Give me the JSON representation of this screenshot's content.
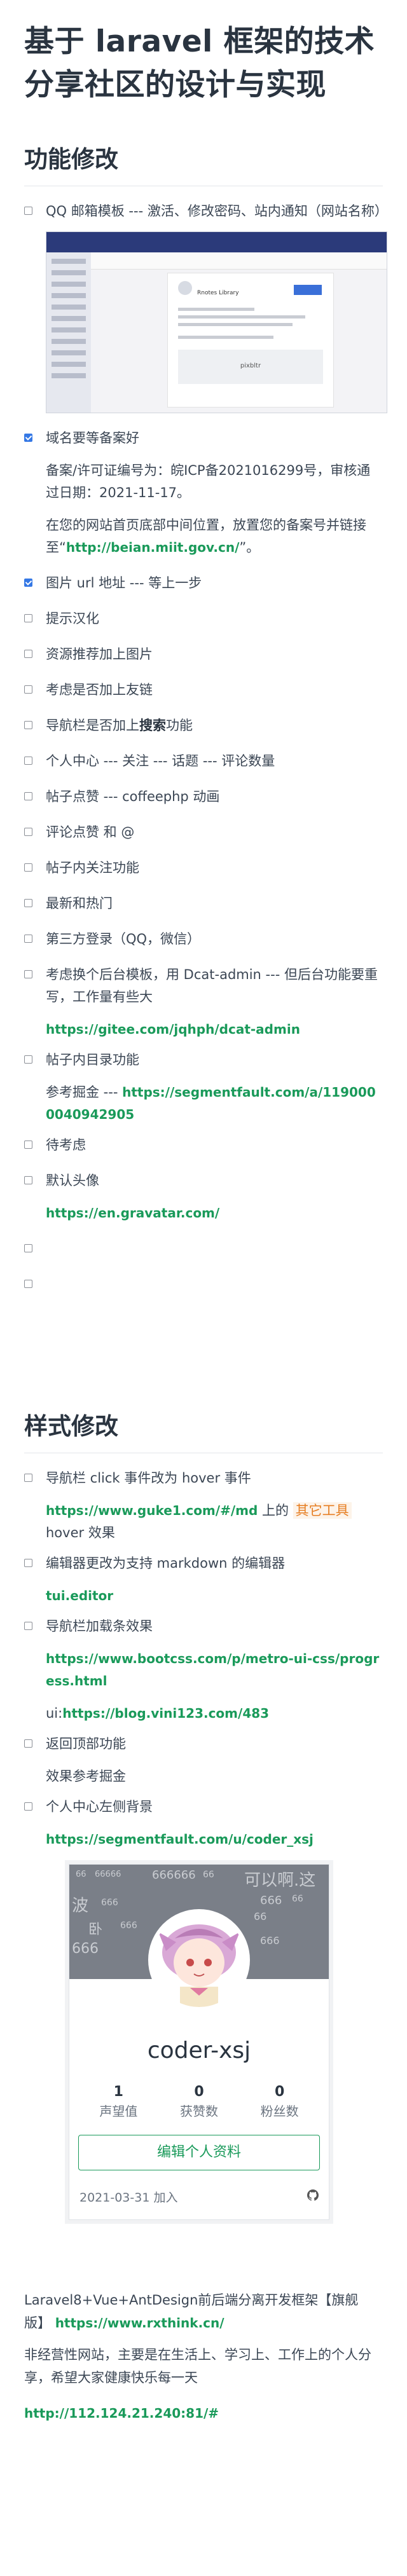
{
  "title": "基于 laravel 框架的技术分享社区的设计与实现",
  "section1": {
    "heading": "功能修改",
    "mail_task": "QQ 邮箱模板 --- 激活、修改密码、站内通知（网站名称）",
    "mail_shot": {
      "sender": "Rnotes Library",
      "pixel_text": "pixbltr"
    },
    "domain_task": "域名要等备案好",
    "domain_note1": "备案/许可证编号为：皖ICP备2021016299号，审核通过日期：2021-11-17。",
    "domain_note2_prefix": "在您的网站首页底部中间位置，放置您的备案号并链接至“",
    "domain_note2_link": "http://beian.miit.gov.cn/",
    "domain_note2_suffix": "”。",
    "items": [
      "图片 url 地址 --- 等上一步",
      "提示汉化",
      "资源推荐加上图片",
      "考虑是否加上友链"
    ],
    "nav_prefix": "导航栏是否加上",
    "nav_bold": "搜索",
    "nav_suffix": "功能",
    "items2": [
      "个人中心 --- 关注 --- 话题 --- 评论数量",
      "帖子点赞 --- coffeephp 动画",
      "评论点赞 和 @",
      "帖子内关注功能",
      "最新和热门",
      "第三方登录（QQ，微信）"
    ],
    "admin_task": "考虑换个后台模板，用 Dcat-admin --- 但后台功能要重写，工作量有些大",
    "admin_link": "https://gitee.com/jqhph/dcat-admin",
    "toc_task": "帖子内目录功能",
    "toc_prefix": "参考掘金 --- ",
    "toc_link": "https://segmentfault.com/a/1190000040942905",
    "pending": "待考虑",
    "avatar_task": "默认头像",
    "avatar_link": "https://en.gravatar.com/"
  },
  "section2": {
    "heading": "样式修改",
    "hover_task": "导航栏 click 事件改为 hover 事件",
    "hover_link": "https://www.guke1.com/#/md",
    "hover_mid": " 上的 ",
    "hover_code": "其它工具",
    "hover_suffix": " hover 效果",
    "editor_task": "编辑器更改为支持 markdown 的编辑器",
    "editor_link": "tui.editor",
    "nav_effect_task": "导航栏加载条效果",
    "nav_effect_link": "https://www.bootcss.com/p/metro-ui-css/progress.html",
    "ui_prefix": "ui:",
    "ui_link": "https://blog.vini123.com/483",
    "top_task": "返回顶部功能",
    "top_note": "效果参考掘金",
    "center_task": "个人中心左侧背景",
    "center_link": "https://segmentfault.com/u/coder_xsj"
  },
  "profile": {
    "banner_words": [
      "66",
      "66666",
      "666666",
      "66",
      "可以啊.这",
      "波",
      "666",
      "666",
      "66",
      "66",
      "卧",
      "666",
      "666",
      "666"
    ],
    "name": "coder-xsj",
    "stats": [
      {
        "value": "1",
        "label": "声望值"
      },
      {
        "value": "0",
        "label": "获赞数"
      },
      {
        "value": "0",
        "label": "粉丝数"
      }
    ],
    "edit_label": "编辑个人资料",
    "joined": "2021-03-31 加入"
  },
  "footer": {
    "line1": "Laravel8+Vue+AntDesign前后端分离开发框架【旗舰版】",
    "line1_link": "https://www.rxthink.cn/",
    "line2": "非经营性网站，主要是在生活上、学习上、工作上的个人分享，希望大家健康快乐每一天",
    "line3_link": "http://112.124.21.240:81/#"
  }
}
